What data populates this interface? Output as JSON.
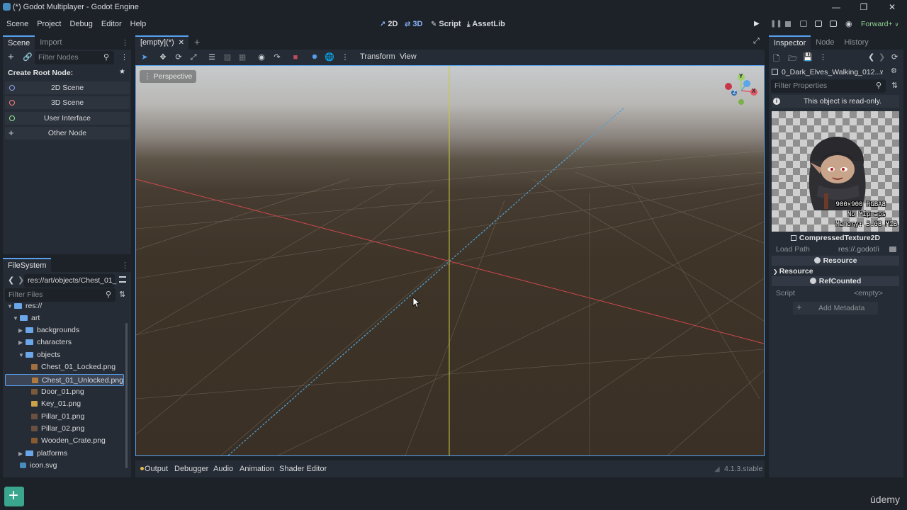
{
  "window": {
    "title": "(*) Godot Multiplayer - Godot Engine",
    "controls": [
      "—",
      "❐",
      "✕"
    ]
  },
  "menu": [
    "Scene",
    "Project",
    "Debug",
    "Editor",
    "Help"
  ],
  "workspaces": [
    {
      "icon": "↗",
      "label": "2D"
    },
    {
      "icon": "⇄",
      "label": "3D"
    },
    {
      "icon": "✎",
      "label": "Script"
    },
    {
      "icon": "⤓",
      "label": "AssetLib"
    }
  ],
  "renderer": "Forward+",
  "scene_dock": {
    "tabs": [
      "Scene",
      "Import"
    ],
    "filter_placeholder": "Filter Nodes",
    "create_root_label": "Create Root Node:",
    "root_buttons": [
      {
        "label": "2D Scene",
        "color": "#8da5f3"
      },
      {
        "label": "3D Scene",
        "color": "#fc7f7f"
      },
      {
        "label": "User Interface",
        "color": "#8eef97"
      },
      {
        "label": "Other Node",
        "color": "#e0e0e0"
      }
    ]
  },
  "filesystem": {
    "tab": "FileSystem",
    "path": "res://art/objects/Chest_01_",
    "filter_placeholder": "Filter Files",
    "tree": [
      {
        "label": "res://",
        "kind": "folder"
      },
      {
        "label": "art",
        "kind": "folder"
      },
      {
        "label": "backgrounds",
        "kind": "folder"
      },
      {
        "label": "characters",
        "kind": "folder"
      },
      {
        "label": "objects",
        "kind": "folder"
      },
      {
        "label": "Chest_01_Locked.png",
        "kind": "file"
      },
      {
        "label": "Chest_01_Unlocked.png",
        "kind": "file"
      },
      {
        "label": "Door_01.png",
        "kind": "file"
      },
      {
        "label": "Key_01.png",
        "kind": "file"
      },
      {
        "label": "Pillar_01.png",
        "kind": "file"
      },
      {
        "label": "Pillar_02.png",
        "kind": "file"
      },
      {
        "label": "Wooden_Crate.png",
        "kind": "file"
      },
      {
        "label": "platforms",
        "kind": "folder"
      },
      {
        "label": "icon.svg",
        "kind": "file"
      }
    ]
  },
  "editor": {
    "scene_tab": "[empty](*)",
    "toolbar_menus": [
      "Transform",
      "View"
    ],
    "viewport_label": "Perspective",
    "gizmo_axes": [
      "Y",
      "X",
      "Z"
    ]
  },
  "bottom_panel": {
    "tabs": [
      "Output",
      "Debugger",
      "Audio",
      "Animation",
      "Shader Editor"
    ],
    "version": "4.1.3.stable"
  },
  "inspector": {
    "tabs": [
      "Inspector",
      "Node",
      "History"
    ],
    "resource_name": "0_Dark_Elves_Walking_012....",
    "filter_placeholder": "Filter Properties",
    "readonly_notice": "This object is read-only.",
    "preview_info": [
      "900×900 RGBA8",
      "No Mipmaps",
      "Memory: 3.08 MiB"
    ],
    "type_header": "CompressedTexture2D",
    "load_path_label": "Load Path",
    "load_path_value": "res://.godot/i",
    "section_resource": "Resource",
    "group_resource": "Resource",
    "section_refcounted": "RefCounted",
    "script_label": "Script",
    "script_value": "<empty>",
    "add_metadata": "Add Metadata"
  },
  "watermark": "údemy",
  "colors": {
    "accent": "#57a1ef",
    "x_axis": "#d2484f",
    "y_axis": "#c9c93a",
    "z_axis": "#4fa3d9"
  }
}
